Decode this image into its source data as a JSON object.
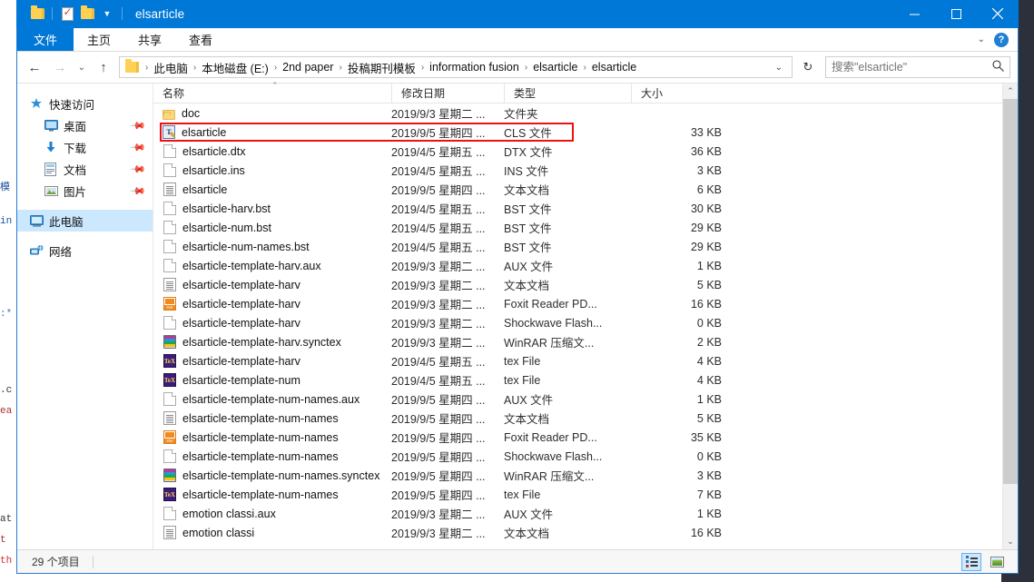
{
  "window": {
    "title": "elsarticle",
    "quick_access": [
      "folder-icon",
      "properties-icon",
      "new-folder-icon",
      "customize-dropdown-icon"
    ],
    "controls": {
      "minimize": "—",
      "maximize": "▢",
      "close": "✕"
    }
  },
  "ribbon": {
    "tabs": [
      {
        "label": "文件",
        "active": true
      },
      {
        "label": "主页",
        "active": false
      },
      {
        "label": "共享",
        "active": false
      },
      {
        "label": "查看",
        "active": false
      }
    ],
    "collapse_icon": "chevron-down-icon",
    "help_label": "?"
  },
  "addressbar": {
    "back_icon": "←",
    "forward_icon": "→",
    "recent_icon": "⌄",
    "up_icon": "↑",
    "breadcrumbs": [
      "此电脑",
      "本地磁盘 (E:)",
      "2nd paper",
      "投稿期刊模板",
      "information fusion",
      "elsarticle",
      "elsarticle"
    ],
    "separator": "›",
    "dropdown_icon": "⌄",
    "refresh_icon": "↻"
  },
  "search": {
    "placeholder": "搜索\"elsarticle\"",
    "value": "",
    "icon": "search-icon"
  },
  "navpane": {
    "groups": [
      {
        "header": {
          "label": "快速访问",
          "icon": "pin-star-icon"
        },
        "items": [
          {
            "label": "桌面",
            "icon": "desktop-icon",
            "pinned": true
          },
          {
            "label": "下载",
            "icon": "downloads-icon",
            "pinned": true
          },
          {
            "label": "文档",
            "icon": "documents-icon",
            "pinned": true
          },
          {
            "label": "图片",
            "icon": "pictures-icon",
            "pinned": true
          }
        ]
      },
      {
        "header": null,
        "items": [
          {
            "label": "此电脑",
            "icon": "this-pc-icon",
            "pinned": false,
            "selected": true
          }
        ]
      },
      {
        "header": null,
        "items": [
          {
            "label": "网络",
            "icon": "network-icon",
            "pinned": false
          }
        ]
      }
    ]
  },
  "filelist": {
    "columns": [
      {
        "key": "name",
        "label": "名称",
        "sorted": true
      },
      {
        "key": "date",
        "label": "修改日期"
      },
      {
        "key": "type",
        "label": "类型"
      },
      {
        "key": "size",
        "label": "大小"
      }
    ],
    "rows": [
      {
        "icon": "folder-icon",
        "name": "doc",
        "date": "2019/9/3 星期二 ...",
        "type": "文件夹",
        "size": ""
      },
      {
        "icon": "cls-file-icon",
        "name": "elsarticle",
        "date": "2019/9/5 星期四 ...",
        "type": "CLS 文件",
        "size": "33 KB",
        "highlighted": true
      },
      {
        "icon": "blank-file-icon",
        "name": "elsarticle.dtx",
        "date": "2019/4/5 星期五 ...",
        "type": "DTX 文件",
        "size": "36 KB"
      },
      {
        "icon": "blank-file-icon",
        "name": "elsarticle.ins",
        "date": "2019/4/5 星期五 ...",
        "type": "INS 文件",
        "size": "3 KB"
      },
      {
        "icon": "text-file-icon",
        "name": "elsarticle",
        "date": "2019/9/5 星期四 ...",
        "type": "文本文档",
        "size": "6 KB"
      },
      {
        "icon": "blank-file-icon",
        "name": "elsarticle-harv.bst",
        "date": "2019/4/5 星期五 ...",
        "type": "BST 文件",
        "size": "30 KB"
      },
      {
        "icon": "blank-file-icon",
        "name": "elsarticle-num.bst",
        "date": "2019/4/5 星期五 ...",
        "type": "BST 文件",
        "size": "29 KB"
      },
      {
        "icon": "blank-file-icon",
        "name": "elsarticle-num-names.bst",
        "date": "2019/4/5 星期五 ...",
        "type": "BST 文件",
        "size": "29 KB"
      },
      {
        "icon": "blank-file-icon",
        "name": "elsarticle-template-harv.aux",
        "date": "2019/9/3 星期二 ...",
        "type": "AUX 文件",
        "size": "1 KB"
      },
      {
        "icon": "text-file-icon",
        "name": "elsarticle-template-harv",
        "date": "2019/9/3 星期二 ...",
        "type": "文本文档",
        "size": "5 KB"
      },
      {
        "icon": "pdf-file-icon",
        "name": "elsarticle-template-harv",
        "date": "2019/9/3 星期二 ...",
        "type": "Foxit Reader PD...",
        "size": "16 KB"
      },
      {
        "icon": "blank-file-icon",
        "name": "elsarticle-template-harv",
        "date": "2019/9/3 星期二 ...",
        "type": "Shockwave Flash...",
        "size": "0 KB"
      },
      {
        "icon": "rar-file-icon",
        "name": "elsarticle-template-harv.synctex",
        "date": "2019/9/3 星期二 ...",
        "type": "WinRAR 压缩文...",
        "size": "2 KB"
      },
      {
        "icon": "tex-file-icon",
        "name": "elsarticle-template-harv",
        "date": "2019/4/5 星期五 ...",
        "type": "tex File",
        "size": "4 KB"
      },
      {
        "icon": "tex-file-icon",
        "name": "elsarticle-template-num",
        "date": "2019/4/5 星期五 ...",
        "type": "tex File",
        "size": "4 KB"
      },
      {
        "icon": "blank-file-icon",
        "name": "elsarticle-template-num-names.aux",
        "date": "2019/9/5 星期四 ...",
        "type": "AUX 文件",
        "size": "1 KB"
      },
      {
        "icon": "text-file-icon",
        "name": "elsarticle-template-num-names",
        "date": "2019/9/5 星期四 ...",
        "type": "文本文档",
        "size": "5 KB"
      },
      {
        "icon": "pdf-file-icon",
        "name": "elsarticle-template-num-names",
        "date": "2019/9/5 星期四 ...",
        "type": "Foxit Reader PD...",
        "size": "35 KB"
      },
      {
        "icon": "blank-file-icon",
        "name": "elsarticle-template-num-names",
        "date": "2019/9/5 星期四 ...",
        "type": "Shockwave Flash...",
        "size": "0 KB"
      },
      {
        "icon": "rar-file-icon",
        "name": "elsarticle-template-num-names.synctex",
        "date": "2019/9/5 星期四 ...",
        "type": "WinRAR 压缩文...",
        "size": "3 KB"
      },
      {
        "icon": "tex-file-icon",
        "name": "elsarticle-template-num-names",
        "date": "2019/9/5 星期四 ...",
        "type": "tex File",
        "size": "7 KB"
      },
      {
        "icon": "blank-file-icon",
        "name": "emotion classi.aux",
        "date": "2019/9/3 星期二 ...",
        "type": "AUX 文件",
        "size": "1 KB"
      },
      {
        "icon": "text-file-icon",
        "name": "emotion classi",
        "date": "2019/9/3 星期二 ...",
        "type": "文本文档",
        "size": "16 KB"
      }
    ]
  },
  "statusbar": {
    "count_label": "29 个项目",
    "views": [
      {
        "name": "details-view",
        "active": true
      },
      {
        "name": "thumbnail-view",
        "active": false
      }
    ]
  },
  "scrollbar": {
    "up_arrow": "⌃",
    "down_arrow": "⌄"
  }
}
